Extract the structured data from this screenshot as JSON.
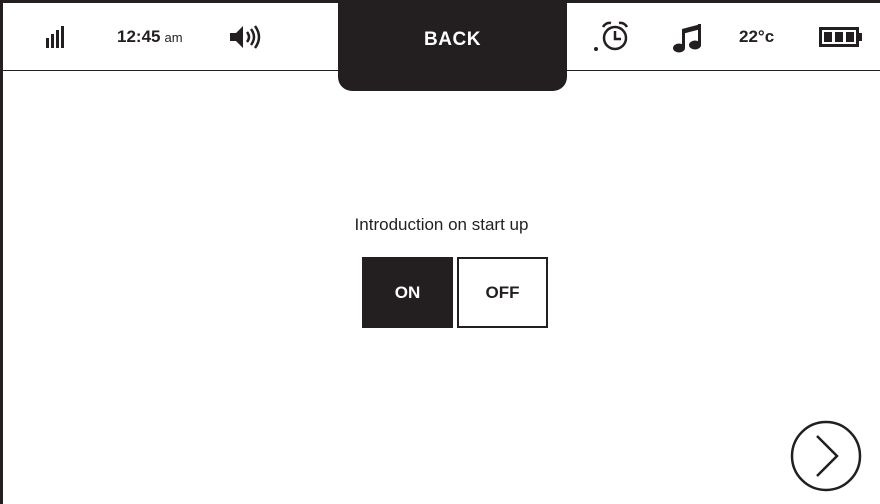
{
  "status_bar": {
    "signal_icon": "signal-strength-icon",
    "time": "12:45",
    "time_suffix": "am",
    "volume_icon": "volume-icon",
    "alarm_icon": "alarm-clock-icon",
    "music_icon": "music-note-icon",
    "temperature": "22°c",
    "battery_icon": "battery-icon"
  },
  "header": {
    "back_label": "BACK"
  },
  "main": {
    "setting_label": "Introduction on start up",
    "toggle": {
      "on_label": "ON",
      "off_label": "OFF",
      "selected": "ON"
    },
    "next_icon": "chevron-right-circle-icon"
  },
  "colors": {
    "ink": "#231f20",
    "background": "#ffffff"
  }
}
